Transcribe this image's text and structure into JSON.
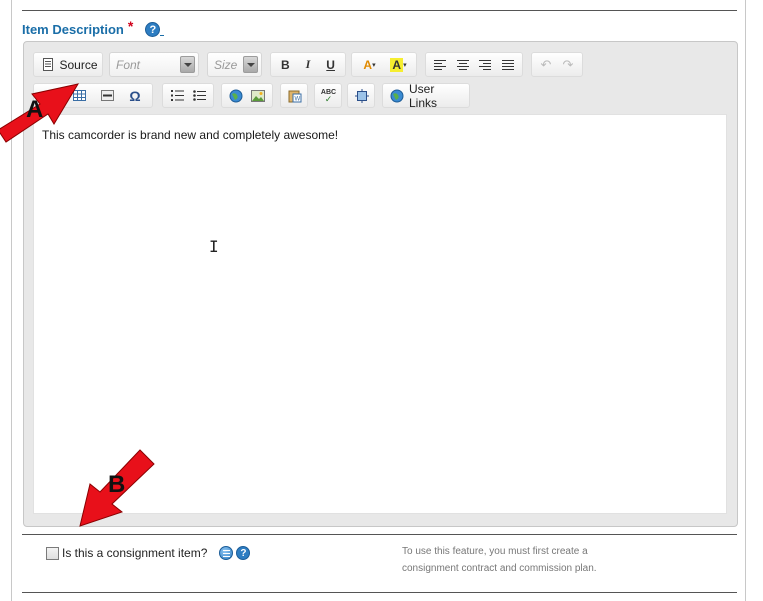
{
  "field": {
    "label": "Item Description",
    "required_mark": "*",
    "help_glyph": "?"
  },
  "toolbar": {
    "source_label": "Source",
    "font_placeholder": "Font",
    "size_placeholder": "Size",
    "bold": "B",
    "italic": "I",
    "underline": "U",
    "text_color": "A",
    "bg_color": "A",
    "spellcheck": "ABC",
    "user_links_label": "User Links"
  },
  "editor": {
    "content": "This camcorder is brand new and completely awesome!"
  },
  "annotations": {
    "a": "A",
    "b": "B"
  },
  "consignment": {
    "label": "Is this a consignment item?",
    "help_glyph": "?",
    "note_line1": "To use this feature, you must first create a",
    "note_line2": "consignment contract and commission plan."
  },
  "colors": {
    "label_blue": "#1a6ea8",
    "required_red": "#d0021b",
    "arrow_red": "#e8101a"
  }
}
